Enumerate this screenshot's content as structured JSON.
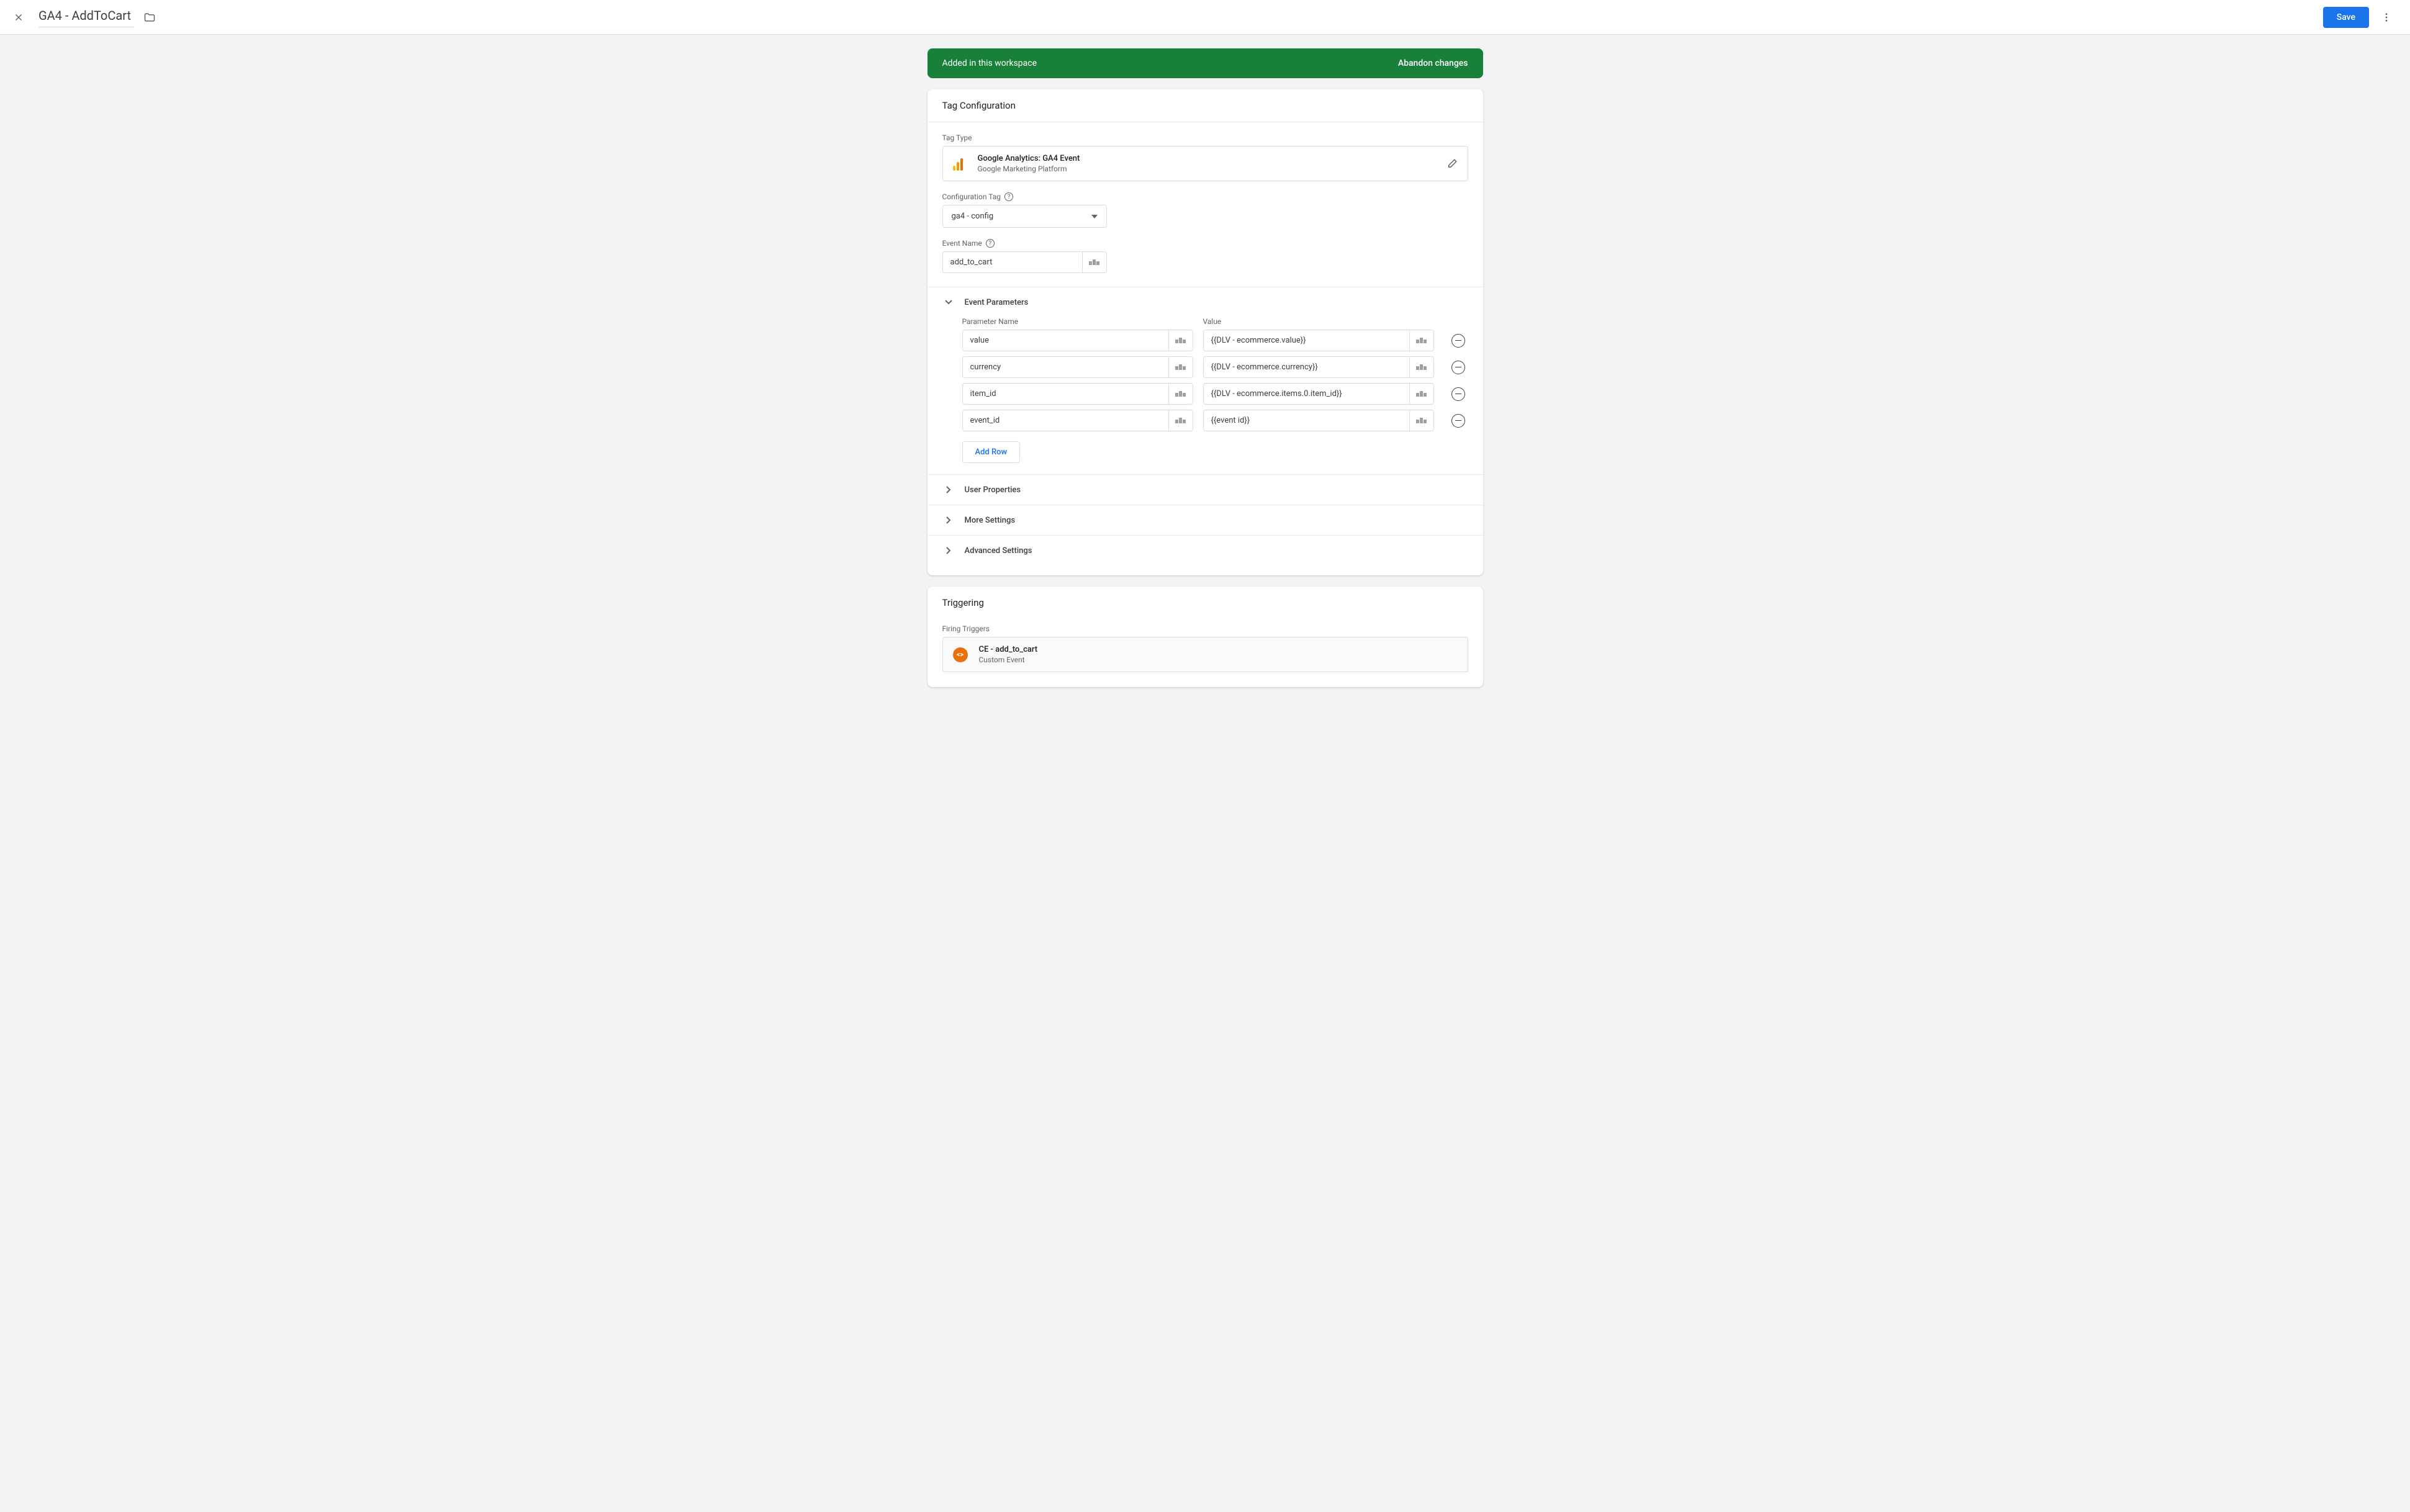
{
  "header": {
    "title": "GA4 - AddToCart",
    "save_label": "Save"
  },
  "banner": {
    "message": "Added in this workspace",
    "abandon_label": "Abandon changes"
  },
  "tagConfig": {
    "title": "Tag Configuration",
    "tagType": {
      "label": "Tag Type",
      "title": "Google Analytics: GA4 Event",
      "subtitle": "Google Marketing Platform"
    },
    "configTag": {
      "label": "Configuration Tag",
      "value": "ga4 - config"
    },
    "eventName": {
      "label": "Event Name",
      "value": "add_to_cart"
    },
    "eventParams": {
      "title": "Event Parameters",
      "name_header": "Parameter Name",
      "value_header": "Value",
      "rows": [
        {
          "name": "value",
          "value": "{{DLV - ecommerce.value}}"
        },
        {
          "name": "currency",
          "value": "{{DLV - ecommerce.currency}}"
        },
        {
          "name": "item_id",
          "value": "{{DLV - ecommerce.items.0.item_id}}"
        },
        {
          "name": "event_id",
          "value": "{{event id}}"
        }
      ],
      "add_row_label": "Add Row"
    },
    "userProperties": {
      "title": "User Properties"
    },
    "moreSettings": {
      "title": "More Settings"
    },
    "advancedSettings": {
      "title": "Advanced Settings"
    }
  },
  "triggering": {
    "title": "Triggering",
    "label": "Firing Triggers",
    "trigger": {
      "title": "CE - add_to_cart",
      "subtitle": "Custom Event"
    }
  }
}
